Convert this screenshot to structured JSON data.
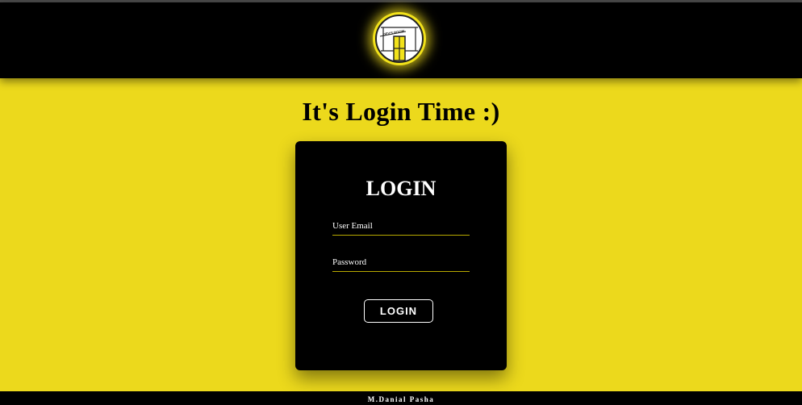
{
  "header": {
    "logo_text": "DEV'S ROOM",
    "logo_icon": "room-logo-icon"
  },
  "main": {
    "title": "It's Login Time :)"
  },
  "login_card": {
    "title": "LOGIN",
    "email_placeholder": "User Email",
    "email_value": "",
    "password_placeholder": "Password",
    "password_value": "",
    "submit_label": "LOGIN"
  },
  "footer": {
    "credit": "M.Danial Pasha"
  },
  "colors": {
    "background": "#ecd91c",
    "header": "#000000",
    "card": "#000000",
    "accent": "#f2e21a"
  }
}
